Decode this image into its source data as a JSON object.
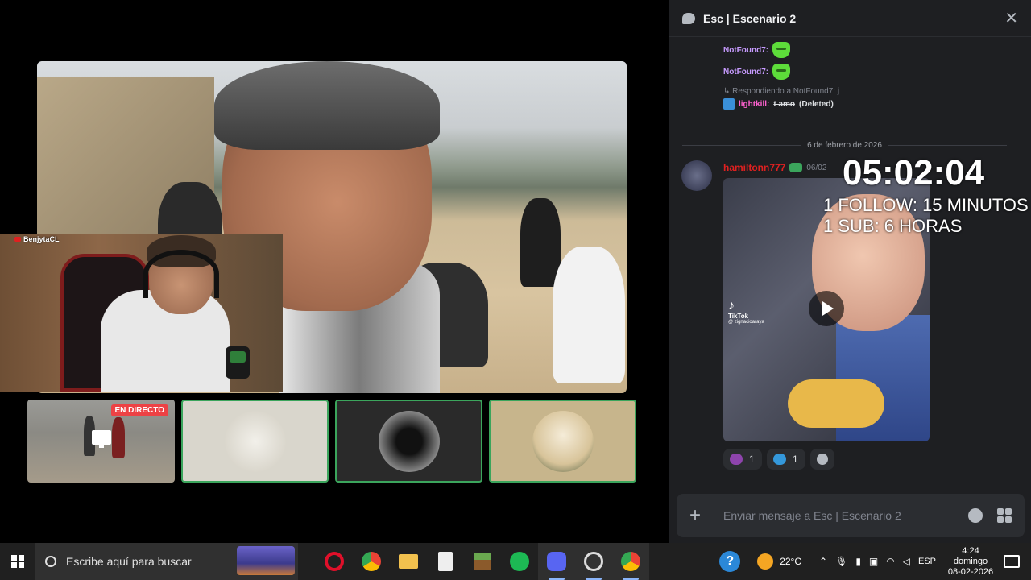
{
  "stream": {
    "cam_name": "BenjytaCL"
  },
  "thumbnails": {
    "live_label": "EN DIRECTO"
  },
  "chat": {
    "title": "Esc | Escenario 2",
    "messages": [
      {
        "author": "NotFound7:"
      },
      {
        "author": "NotFound7:"
      }
    ],
    "reply_text": "Respondiendo a NotFound7: j",
    "deleted_author": "lightkill:",
    "deleted_text": "t amo",
    "deleted_note": "(Deleted)",
    "date_divider": "6 de febrero de 2026",
    "post_author": "hamiltonn777",
    "post_time": "06/02",
    "tiktok_label": "TikTok",
    "tiktok_handle": "@ zignacioaraya",
    "overlay_timer": "05:02:04",
    "overlay_line1": "1 FOLLOW: 15 MINUTOS",
    "overlay_line2": "1 SUB: 6 HORAS",
    "reactions": [
      {
        "icon": "eggplant-icon",
        "count": "1",
        "color": "#8e44ad"
      },
      {
        "icon": "droplets-icon",
        "count": "1",
        "color": "#3498db"
      }
    ],
    "input_placeholder": "Enviar mensaje a Esc | Escenario 2"
  },
  "taskbar": {
    "search_placeholder": "Escribe aquí para buscar",
    "temperature": "22°C",
    "language": "ESP",
    "time": "4:24",
    "day": "domingo",
    "date": "08-02-2026",
    "apps": [
      {
        "name": "opera-icon",
        "color": "#e0102a"
      },
      {
        "name": "chrome-icon",
        "color": "#4caf50"
      },
      {
        "name": "file-explorer-icon",
        "color": "#f2c14e"
      },
      {
        "name": "epic-games-icon",
        "color": "#2a2a2a"
      },
      {
        "name": "minecraft-icon",
        "color": "#6b8e23"
      },
      {
        "name": "spotify-icon",
        "color": "#1db954"
      },
      {
        "name": "discord-icon",
        "color": "#5865f2"
      },
      {
        "name": "obs-icon",
        "color": "#444"
      },
      {
        "name": "chrome-alt-icon",
        "color": "#4caf50"
      }
    ]
  },
  "colors": {
    "discord_bg": "#1e1f22",
    "live_red": "#ed4245",
    "select_green": "#3ba55c"
  }
}
